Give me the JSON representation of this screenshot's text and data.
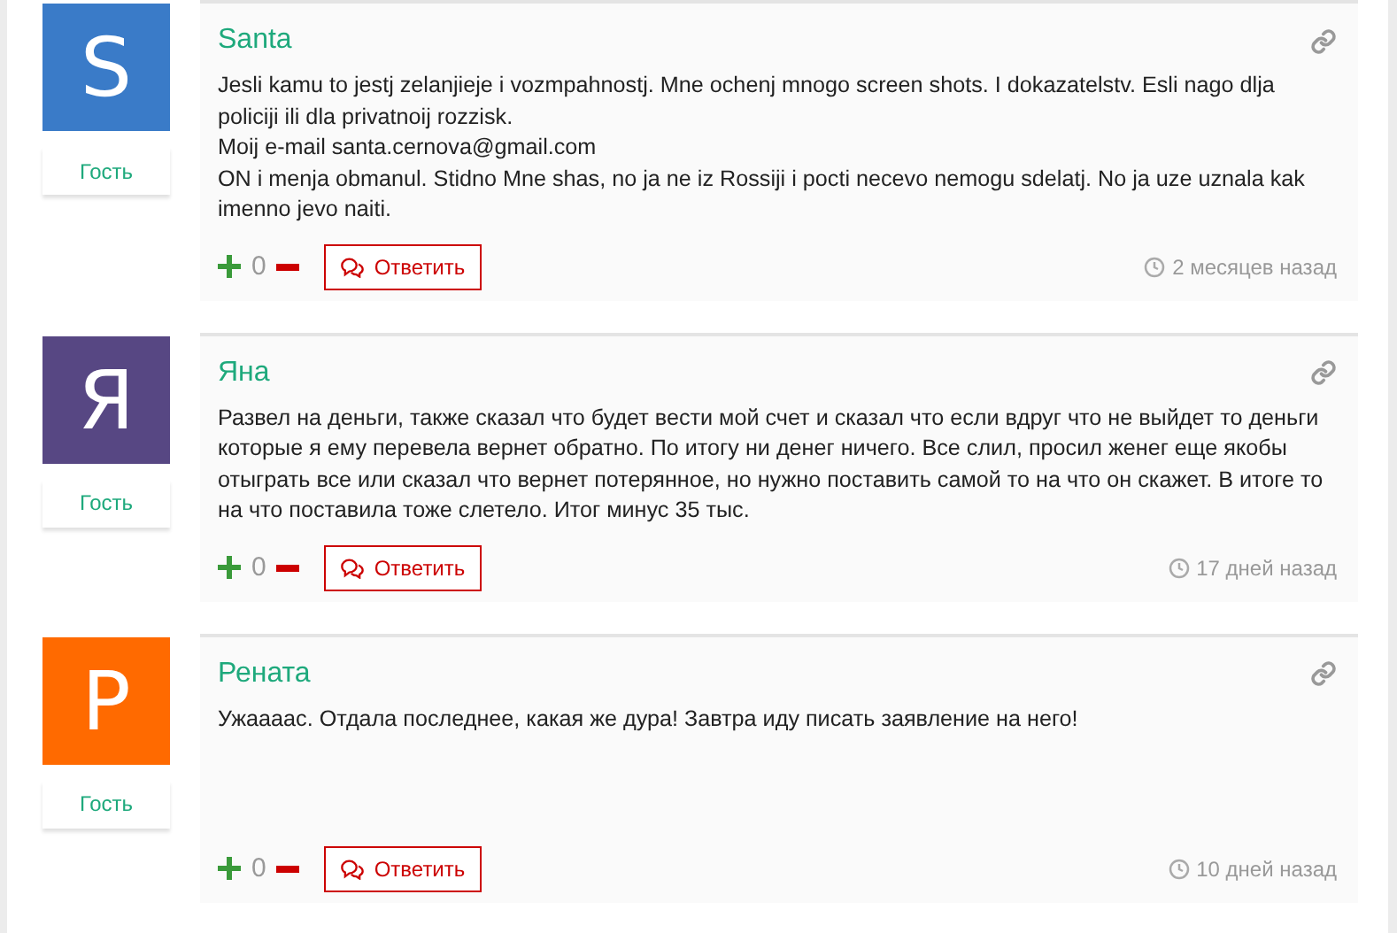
{
  "comments": [
    {
      "avatar_letter": "S",
      "color": "#3a7bc8",
      "role": "Гость",
      "author": "Santa",
      "paragraphs": [
        "Jesli kamu to jestj zelanjieje i vozmpahnostj. Mne ochenj mnogo screen shots. I dokazatelstv. Esli nago dlja policiji ili dla privatnoij rozzisk.",
        "Moij e-mail santa.cernova@gmail.com",
        "ON i menja obmanul. Stidno Mne shas, no ja ne iz Rossiji i pocti necevo nemogu sdelatj. No ja uze uznala kak imenno jevo naiti."
      ],
      "score": "0",
      "reply": "Ответить",
      "time": "2 месяцев назад"
    },
    {
      "avatar_letter": "Я",
      "color": "#574783",
      "role": "Гость",
      "author": "Яна",
      "paragraphs": [
        "Развел на деньги, также сказал что будет вести мой счет и сказал что если вдруг что не выйдет то деньги которые я ему перевела вернет обратно. По итогу ни денег ничего. Все слил, просил женег еще якобы отыграть все или сказал что вернет потерянное, но нужно поставить самой то на что он скажет. В итоге то на что поставила тоже слетело. Итог минус 35 тыс."
      ],
      "score": "0",
      "reply": "Ответить",
      "time": "17 дней назад"
    },
    {
      "avatar_letter": "P",
      "color": "#ff6a00",
      "role": "Гость",
      "author": "Рената",
      "paragraphs": [
        "Ужаааас. Отдала последнее, какая же дура! Завтра иду писать заявление на него!"
      ],
      "score": "0",
      "reply": "Ответить",
      "time": "10 дней назад"
    }
  ]
}
